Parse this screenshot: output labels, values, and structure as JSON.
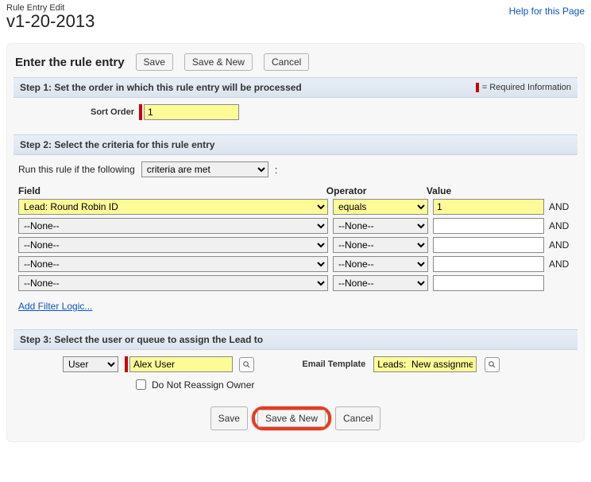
{
  "header": {
    "subtitle": "Rule Entry Edit",
    "title": "v1-20-2013",
    "help": "Help for this Page"
  },
  "panel": {
    "heading": "Enter the rule entry",
    "btn_save": "Save",
    "btn_savenew": "Save & New",
    "btn_cancel": "Cancel"
  },
  "step1": {
    "bar": "Step 1: Set the order in which this rule entry will be processed",
    "required_note": "= Required Information",
    "sort_label": "Sort Order",
    "sort_value": "1"
  },
  "step2": {
    "bar": "Step 2: Select the criteria for this rule entry",
    "run_prefix": "Run this rule if the following",
    "mode_option": "criteria are met",
    "head_field": "Field",
    "head_operator": "Operator",
    "head_value": "Value",
    "and": "AND",
    "none": "--None--",
    "rows": [
      {
        "field": "Lead: Round Robin ID",
        "operator": "equals",
        "value": "1",
        "hl": true,
        "and": true
      },
      {
        "field": "--None--",
        "operator": "--None--",
        "value": "",
        "hl": false,
        "and": true
      },
      {
        "field": "--None--",
        "operator": "--None--",
        "value": "",
        "hl": false,
        "and": true
      },
      {
        "field": "--None--",
        "operator": "--None--",
        "value": "",
        "hl": false,
        "and": true
      },
      {
        "field": "--None--",
        "operator": "--None--",
        "value": "",
        "hl": false,
        "and": false
      }
    ],
    "add_filter": "Add Filter Logic..."
  },
  "step3": {
    "bar": "Step 3: Select the user or queue to assign the Lead to",
    "type_option": "User",
    "assignee": "Alex User",
    "dnr_label": "Do Not Reassign Owner",
    "eml_label": "Email Template",
    "eml_value": "Leads:  New assignme"
  }
}
